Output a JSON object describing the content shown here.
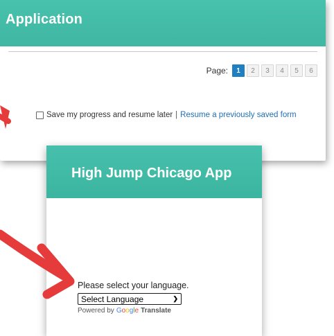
{
  "top_panel": {
    "title": "Application",
    "pager_label": "Page:",
    "pages": [
      "1",
      "2",
      "3",
      "4",
      "5",
      "6"
    ],
    "active_page": "1",
    "save_progress_label": "Save my progress and resume later",
    "separator": "|",
    "resume_link": "Resume a previously saved form"
  },
  "bottom_panel": {
    "title": "High Jump Chicago App",
    "language_prompt": "Please select your language.",
    "language_select_value": "Select Language",
    "powered_by": "Powered by",
    "google_letters": [
      "G",
      "o",
      "o",
      "g",
      "l",
      "e"
    ],
    "translate_label": "Translate"
  },
  "colors": {
    "banner_teal": "#42bba6",
    "active_page_blue": "#1f7fc1",
    "link_blue": "#1f6fb5",
    "arrow_red": "#e63b3b"
  },
  "icons": {
    "arrows": "red-pointer-arrow",
    "select_chevron": "chevron-down-icon"
  }
}
